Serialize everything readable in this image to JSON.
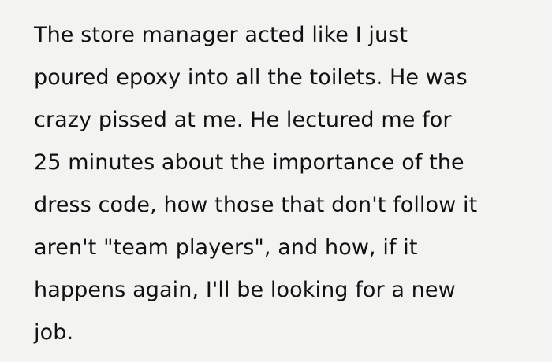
{
  "story": {
    "lines": [
      "The store manager acted like I just",
      "poured epoxy into all the toilets. He was",
      "crazy pissed at me. He lectured me for",
      "25 minutes about the importance of the",
      "dress code, how those that don't follow it",
      "aren't \"team players\", and how, if it",
      "happens again, I'll be looking for a new",
      "job."
    ]
  }
}
